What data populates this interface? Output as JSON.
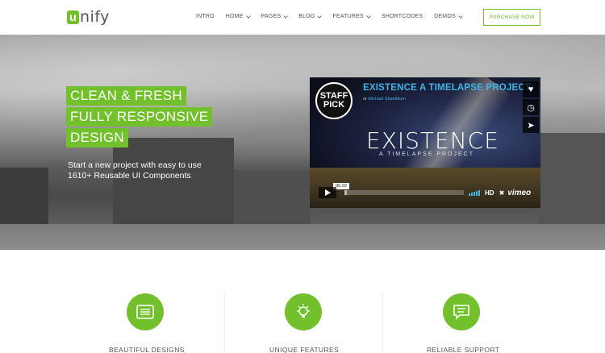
{
  "header": {
    "logo_letter": "u",
    "logo_rest": "nify",
    "nav": [
      {
        "label": "INTRO",
        "dropdown": false
      },
      {
        "label": "HOME",
        "dropdown": true
      },
      {
        "label": "PAGES",
        "dropdown": true
      },
      {
        "label": "BLOG",
        "dropdown": true
      },
      {
        "label": "FEATURES",
        "dropdown": true
      },
      {
        "label": "SHORTCODES",
        "dropdown": false
      },
      {
        "label": "DEMOS",
        "dropdown": true
      }
    ],
    "purchase_label": "PURCHASE NOW"
  },
  "hero": {
    "tagline": [
      "CLEAN & FRESH",
      "FULLY RESPONSIVE",
      "DESIGN"
    ],
    "subtext": "Start a new project with easy to use 1610+ Reusable UI Components"
  },
  "video": {
    "badge": "STAFF\nPICK",
    "title": "EXISTENCE A TIMELAPSE PROJECT",
    "byline_prefix": "or",
    "byline_author": "Michael Shainblum",
    "big_title": "EXISTENCE",
    "sub_title": "A TIMELAPSE PROJECT",
    "side_icons": [
      "heart-icon",
      "clock-icon",
      "send-icon"
    ],
    "timecode": "06:29",
    "hd_label": "HD",
    "brand": "vimeo",
    "progress": 0.02
  },
  "features": [
    {
      "title": "BEAUTIFUL DESIGNS",
      "icon": "layout-icon"
    },
    {
      "title": "UNIQUE FEATURES",
      "icon": "lightbulb-icon"
    },
    {
      "title": "RELIABLE SUPPORT",
      "icon": "chat-icon"
    }
  ],
  "colors": {
    "accent": "#72c02c",
    "vimeo_blue": "#3fb4e6"
  }
}
